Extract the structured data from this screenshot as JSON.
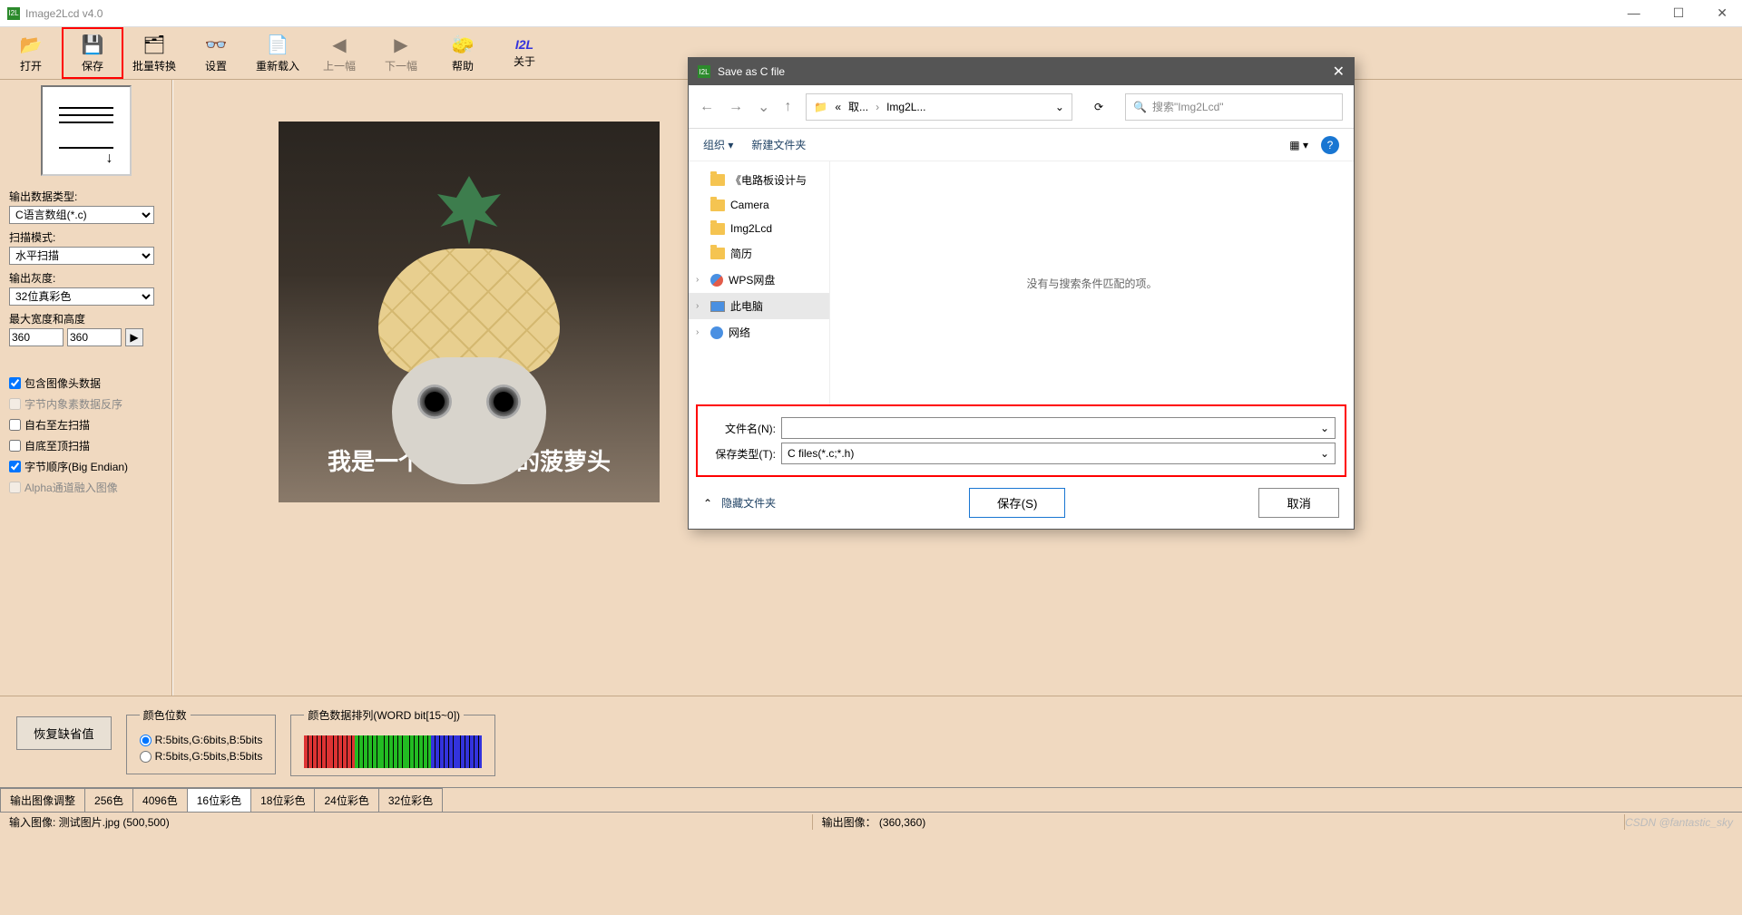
{
  "app": {
    "title": "Image2Lcd v4.0",
    "icon_text": "I2L"
  },
  "window_controls": {
    "minimize": "—",
    "maximize": "☐",
    "close": "✕"
  },
  "toolbar": [
    {
      "icon": "📂",
      "label": "打开",
      "name": "open-button"
    },
    {
      "icon": "💾",
      "label": "保存",
      "name": "save-button",
      "highlighted": true
    },
    {
      "icon": "🗂",
      "label": "批量转换",
      "name": "batch-button"
    },
    {
      "icon": "👓",
      "label": "设置",
      "name": "settings-button"
    },
    {
      "icon": "📄",
      "label": "重新载入",
      "name": "reload-button"
    },
    {
      "icon": "◀",
      "label": "上一幅",
      "name": "prev-button",
      "disabled": true
    },
    {
      "icon": "▶",
      "label": "下一幅",
      "name": "next-button",
      "disabled": true
    },
    {
      "icon": "🧽",
      "label": "帮助",
      "name": "help-button"
    },
    {
      "icon": "I2L",
      "label": "关于",
      "name": "about-button"
    }
  ],
  "sidebar": {
    "output_type_label": "输出数据类型:",
    "output_type_value": "C语言数组(*.c)",
    "scan_mode_label": "扫描模式:",
    "scan_mode_value": "水平扫描",
    "output_gray_label": "输出灰度:",
    "output_gray_value": "32位真彩色",
    "max_dim_label": "最大宽度和高度",
    "max_width": "360",
    "max_height": "360",
    "checks": [
      {
        "label": "包含图像头数据",
        "checked": true,
        "disabled": false
      },
      {
        "label": "字节内象素数据反序",
        "checked": false,
        "disabled": true
      },
      {
        "label": "自右至左扫描",
        "checked": false,
        "disabled": false
      },
      {
        "label": "自底至顶扫描",
        "checked": false,
        "disabled": false
      },
      {
        "label": "字节顺序(Big Endian)",
        "checked": true,
        "disabled": false
      },
      {
        "label": "Alpha通道融入图像",
        "checked": false,
        "disabled": true
      }
    ]
  },
  "preview": {
    "caption": "我是一个没有感情的菠萝头"
  },
  "bottom": {
    "restore_button": "恢复缺省值",
    "color_bits_legend": "颜色位数",
    "radio1": "R:5bits,G:6bits,B:5bits",
    "radio2": "R:5bits,G:5bits,B:5bits",
    "color_arrange_legend": "颜色数据排列(WORD bit[15~0])",
    "bars": [
      "#d33",
      "#d33",
      "#2b2",
      "#2b2",
      "#2b2",
      "#33d",
      "#33d"
    ]
  },
  "tabs": [
    "输出图像调整",
    "256色",
    "4096色",
    "16位彩色",
    "18位彩色",
    "24位彩色",
    "32位彩色"
  ],
  "active_tab_index": 3,
  "statusbar": {
    "input": "输入图像:  测试图片.jpg  (500,500)",
    "output": "输出图像： (360,360)",
    "watermark": "CSDN @fantastic_sky"
  },
  "dialog": {
    "title": "Save as C file",
    "breadcrumb": {
      "root": "«",
      "p1": "取...",
      "p2": "Img2L...",
      "dropdown": "⌄"
    },
    "refresh_icon": "⟳",
    "search_placeholder": "搜索\"Img2Lcd\"",
    "toolbar": {
      "organize": "组织 ▾",
      "new_folder": "新建文件夹",
      "view_icon": "▦ ▾",
      "help": "?"
    },
    "tree": [
      {
        "label": "《电路板设计与",
        "icon": "folder"
      },
      {
        "label": "Camera",
        "icon": "folder"
      },
      {
        "label": "Img2Lcd",
        "icon": "folder"
      },
      {
        "label": "简历",
        "icon": "folder"
      },
      {
        "label": "WPS网盘",
        "icon": "wps",
        "chevron": true
      },
      {
        "label": "此电脑",
        "icon": "pc",
        "chevron": true,
        "selected": true
      },
      {
        "label": "网络",
        "icon": "net",
        "chevron": true
      }
    ],
    "empty_message": "没有与搜索条件匹配的项。",
    "filename_label": "文件名(N):",
    "filename_value": "",
    "savetype_label": "保存类型(T):",
    "savetype_value": "C files(*.c;*.h)",
    "hide_folders": "隐藏文件夹",
    "save_button": "保存(S)",
    "cancel_button": "取消"
  }
}
